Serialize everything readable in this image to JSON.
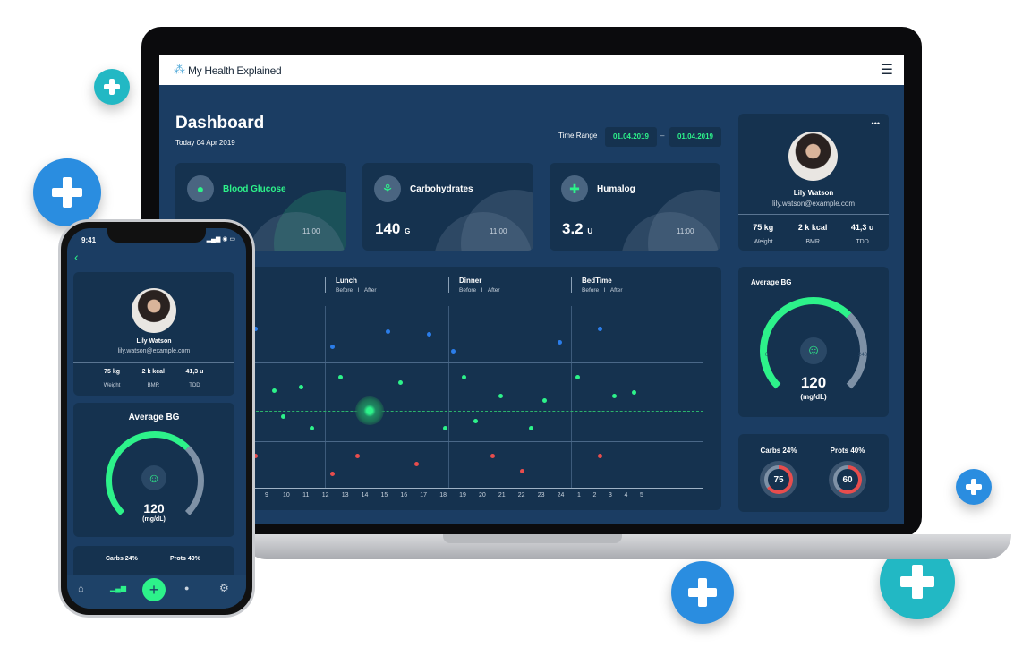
{
  "app": {
    "title": "My Health Explained",
    "menu_icon": "hamburger-icon"
  },
  "dashboard": {
    "title": "Dashboard",
    "date": "Today 04 Apr 2019",
    "time_range_label": "Time Range",
    "from": "01.04.2019",
    "sep": "–",
    "to": "01.04.2019"
  },
  "metrics": [
    {
      "label": "Blood Glucose",
      "value": "",
      "unit": "",
      "time": "11:00",
      "icon": "blood-drop-icon"
    },
    {
      "label": "Carbohydrates",
      "value": "140",
      "unit": "G",
      "time": "11:00",
      "icon": "wheat-icon"
    },
    {
      "label": "Humalog",
      "value": "3.2",
      "unit": "U",
      "time": "11:00",
      "icon": "syringe-icon"
    }
  ],
  "chart": {
    "groups": [
      {
        "name": "Lunch",
        "before": "Before",
        "sep": "I",
        "after": "After"
      },
      {
        "name": "Dinner",
        "before": "Before",
        "sep": "I",
        "after": "After"
      },
      {
        "name": "BedTime",
        "before": "Before",
        "sep": "I",
        "after": "After"
      }
    ],
    "ticks": [
      "9",
      "10",
      "11",
      "12",
      "13",
      "14",
      "15",
      "16",
      "17",
      "18",
      "19",
      "20",
      "21",
      "22",
      "23",
      "24",
      "1",
      "2",
      "3",
      "4",
      "5"
    ],
    "colors": {
      "high": "#2b7de9",
      "normal": "#2df28a",
      "low": "#e84d4d"
    }
  },
  "profile": {
    "name": "Lily Watson",
    "email": "lily.watson@example.com",
    "more": "•••",
    "stats": [
      {
        "value": "75 kg",
        "label": "Weight"
      },
      {
        "value": "2 k kcal",
        "label": "BMR"
      },
      {
        "value": "41,3 u",
        "label": "TDD"
      }
    ]
  },
  "avg_bg": {
    "title": "Average BG",
    "value": "120",
    "unit": "(mg/dL)",
    "min": "0",
    "max": "240",
    "fraction": 0.5
  },
  "macros": [
    {
      "label": "Carbs 24%",
      "value": "75",
      "fraction": 0.65
    },
    {
      "label": "Prots 40%",
      "value": "60",
      "fraction": 0.6
    }
  ],
  "phone": {
    "time": "9:41",
    "nav": [
      "home-icon",
      "stats-icon",
      "add-icon",
      "chat-icon",
      "settings-icon"
    ]
  }
}
